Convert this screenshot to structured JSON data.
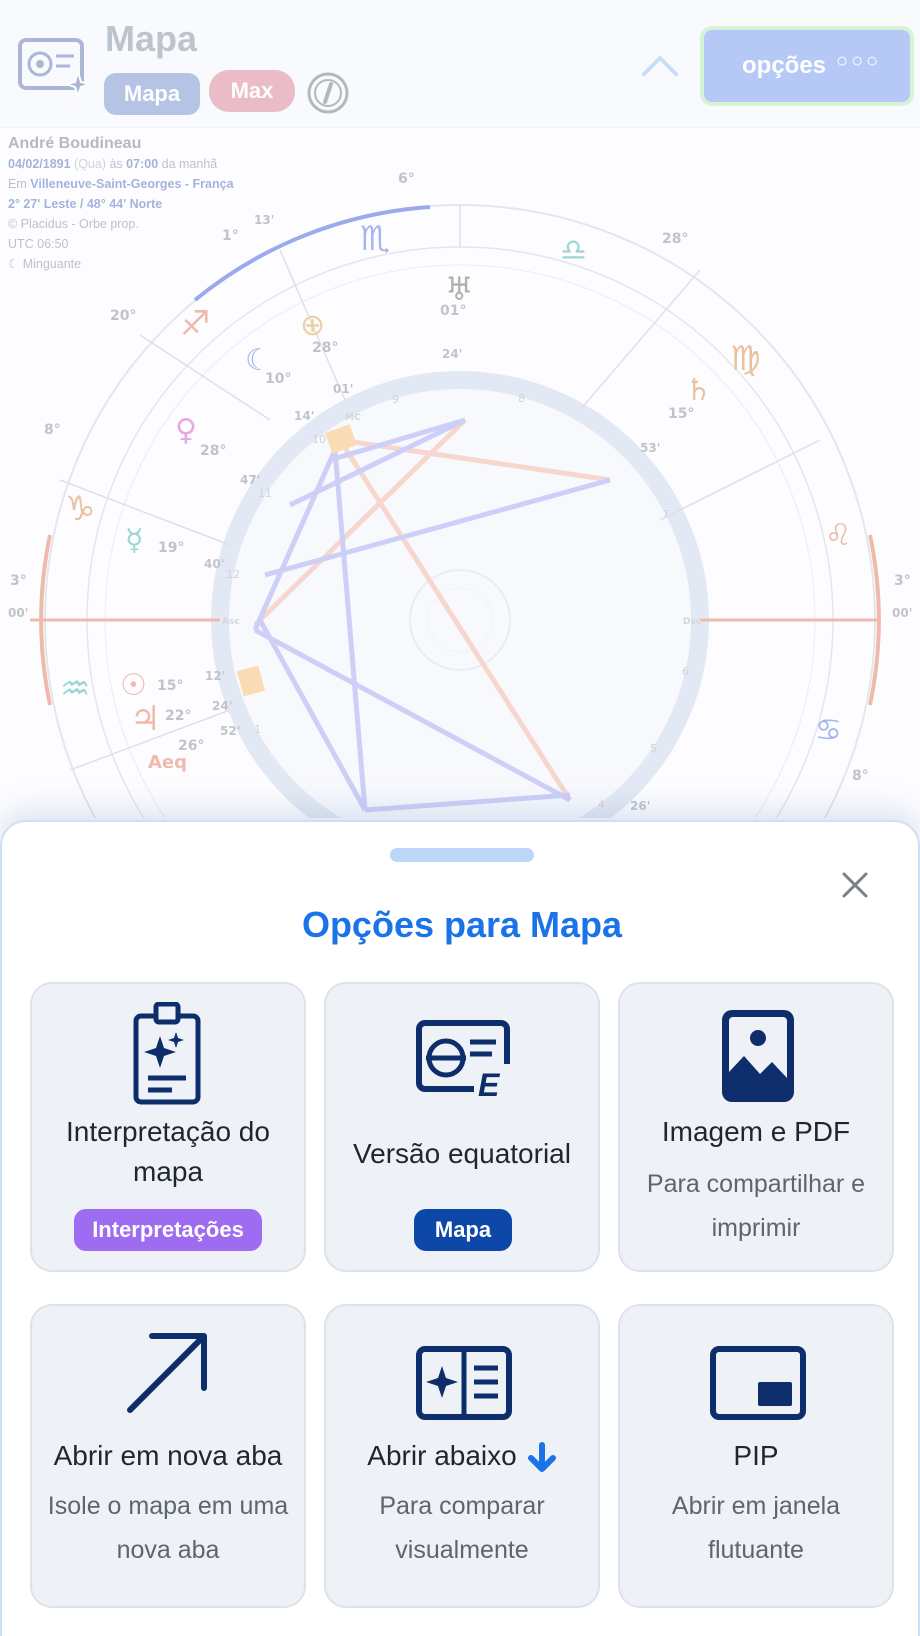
{
  "header": {
    "title": "Mapa",
    "tab_mapa": "Mapa",
    "tab_max": "Max",
    "options_label": "opções",
    "options_dots": "○○○"
  },
  "person": {
    "name": "André Boudineau",
    "date": "04/02/1891",
    "weekday": "(Qua)",
    "at": "às",
    "time": "07:00",
    "period": "da manhã",
    "in": "Em",
    "place": "Villeneuve-Saint-Georges - França",
    "coords": "2° 27' Leste / 48° 44' Norte",
    "system": "Placidus - Orbe prop.",
    "utc": "UTC 06:50",
    "moon_phase": "Minguante"
  },
  "chart_labels": {
    "mc_deg": "6°",
    "top_left_deg": "1°",
    "top_left_min": "13'",
    "left_upper_deg": "20°",
    "left_mid_deg": "8°",
    "asc_deg": "3°",
    "asc_min": "00'",
    "right_top_deg": "28°",
    "dsc_deg": "3°",
    "dsc_min": "00'",
    "right_bottom_deg": "8°",
    "uranus_deg": "01°",
    "uranus_min": "24'",
    "pof_deg": "28°",
    "pof_min": "01'",
    "moon_deg": "10°",
    "moon_min": "14'",
    "venus_deg": "28°",
    "venus_min": "47'",
    "mercury_deg": "19°",
    "mercury_min": "40'",
    "saturn_deg": "15°",
    "saturn_min": "53'",
    "sun_deg": "15°",
    "sun_min": "12'",
    "jupiter_deg": "22°",
    "jupiter_min": "24'",
    "aeq_deg": "26°",
    "aeq_min": "52'",
    "aeq_label": "Aeq",
    "bottom_min": "26'",
    "asc_tag": "Asc",
    "dsc_tag": "Dsc",
    "mc_tag": "MC",
    "house_numbers": [
      "1",
      "4",
      "5",
      "6",
      "7",
      "8",
      "9",
      "10",
      "11",
      "12"
    ]
  },
  "sheet": {
    "title": "Opções para Mapa",
    "cards": [
      {
        "title_1": "Interpretação do",
        "title_2": "mapa",
        "badge": "Interpretações",
        "badge_color": "#9d6cf0"
      },
      {
        "title": "Versão equatorial",
        "badge": "Mapa",
        "badge_color": "#0d47a8"
      },
      {
        "title": "Imagem e PDF",
        "sub_1": "Para compartilhar e",
        "sub_2": "imprimir"
      },
      {
        "title": "Abrir em nova aba",
        "sub_1": "Isole o mapa em uma",
        "sub_2": "nova aba"
      },
      {
        "title": "Abrir abaixo",
        "sub_1": "Para comparar",
        "sub_2": "visualmente"
      },
      {
        "title": "PIP",
        "sub_1": "Abrir em janela",
        "sub_2": "flutuante"
      }
    ]
  },
  "colors": {
    "accent": "#1a73e8",
    "icon_navy": "#0d2d6b",
    "purple_badge": "#9d6cf0",
    "navy_badge": "#0d47a8"
  }
}
